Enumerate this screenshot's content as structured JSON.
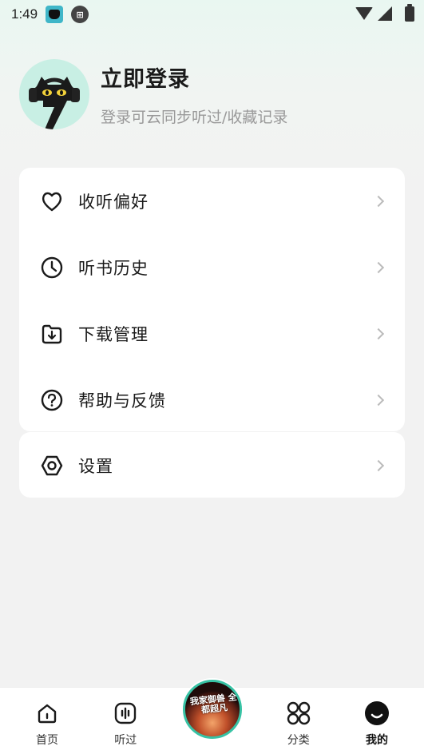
{
  "status_bar": {
    "time": "1:49",
    "icons": [
      "app-icon",
      "circle-badge-icon",
      "wifi-icon",
      "signal-icon",
      "battery-icon"
    ]
  },
  "profile": {
    "title": "立即登录",
    "subtitle": "登录可云同步听过/收藏记录"
  },
  "menu": {
    "items": [
      {
        "label": "收听偏好",
        "icon": "heart-icon"
      },
      {
        "label": "听书历史",
        "icon": "clock-icon"
      },
      {
        "label": "下载管理",
        "icon": "download-folder-icon"
      },
      {
        "label": "帮助与反馈",
        "icon": "help-circle-icon"
      }
    ],
    "settings": {
      "label": "设置",
      "icon": "settings-icon"
    }
  },
  "bottom_nav": {
    "items": [
      {
        "label": "首页",
        "icon": "home-icon"
      },
      {
        "label": "听过",
        "icon": "audio-wave-icon"
      },
      {
        "label": "分类",
        "icon": "category-icon"
      },
      {
        "label": "我的",
        "icon": "profile-icon",
        "active": true
      }
    ],
    "player_cover_text": "我家御兽 全都超凡"
  },
  "colors": {
    "accent": "#37c2a4",
    "avatar_bg": "#c8efe4",
    "muted_text": "#999999"
  }
}
